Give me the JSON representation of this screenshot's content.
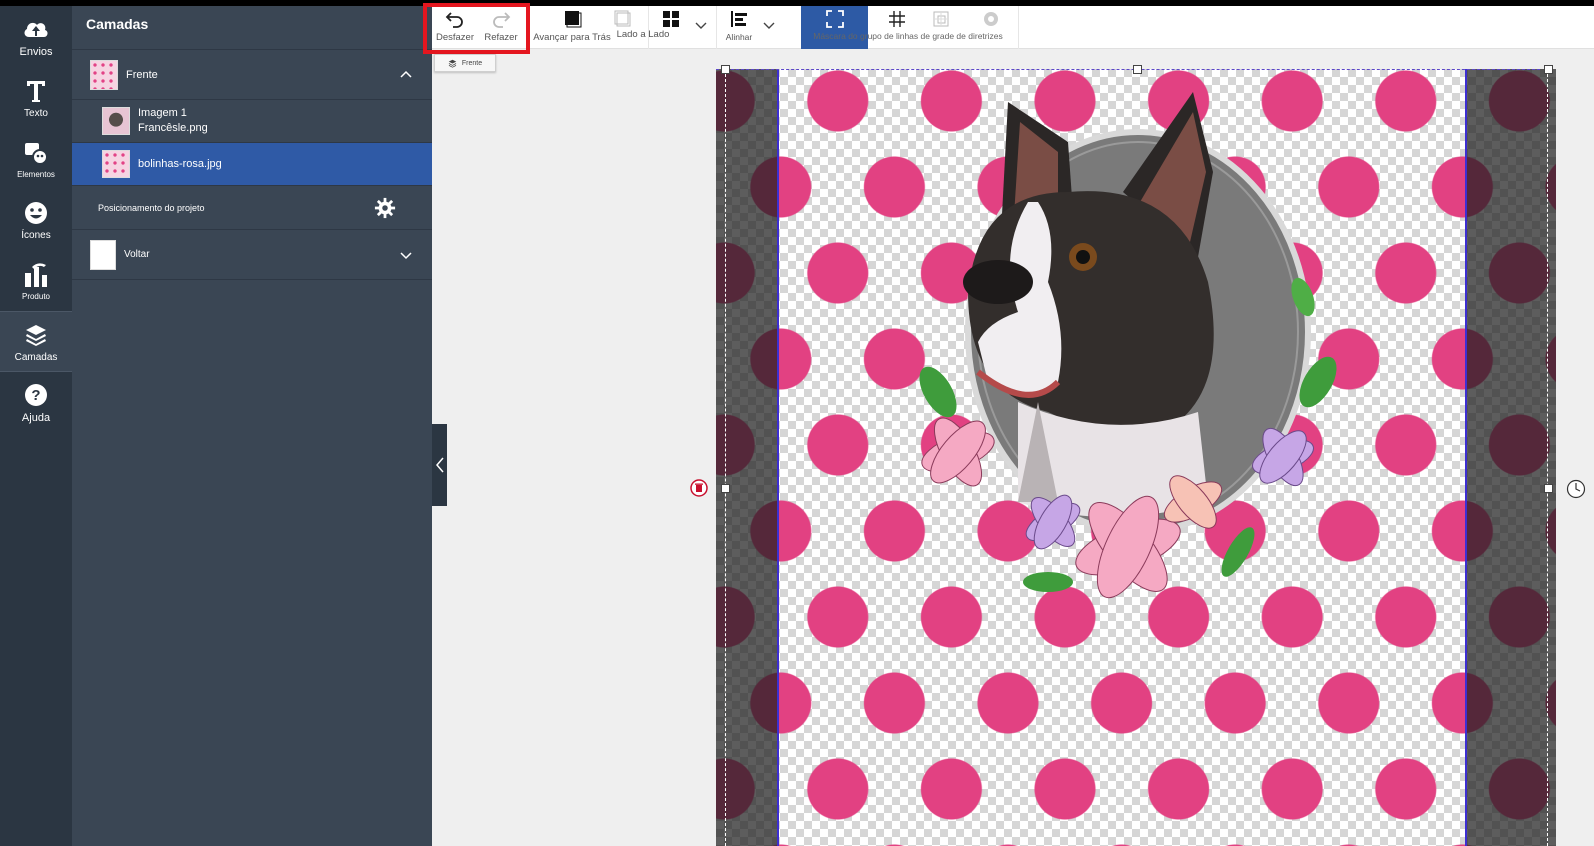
{
  "rail": {
    "items": [
      {
        "label": "Envios",
        "icon": "cloud-upload-icon"
      },
      {
        "label": "Texto",
        "icon": "text-icon"
      },
      {
        "label": "Elementos",
        "icon": "shapes-icon"
      },
      {
        "label": "Ícones",
        "icon": "smiley-icon"
      },
      {
        "label": "Produto",
        "icon": "product-icon"
      },
      {
        "label": "Camadas",
        "icon": "layers-icon"
      },
      {
        "label": "Ajuda",
        "icon": "help-icon"
      }
    ]
  },
  "panel": {
    "title": "Camadas",
    "front_group": "Frente",
    "layers": [
      {
        "line1": "Imagem 1",
        "line2": "Francêsle.png"
      },
      {
        "line1": "bolinhas-rosa.jpg"
      }
    ],
    "project_positioning": "Posicionamento do projeto",
    "back_group": "Voltar"
  },
  "toolbar": {
    "undo": "Desfazer",
    "redo": "Refazer",
    "forward_back": "Avançar para Trás",
    "side_by_side": "Lado a Lado",
    "align": "Alinhar",
    "mask_grid": "Máscara do grupo de linhas de grade de diretrizes"
  },
  "canvas": {
    "side_chip": "Frente"
  },
  "colors": {
    "rail": "#2b3642",
    "panel": "#3a4654",
    "selected": "#2f5aa6",
    "highlight": "#e4161f",
    "dot": "#e24182"
  }
}
